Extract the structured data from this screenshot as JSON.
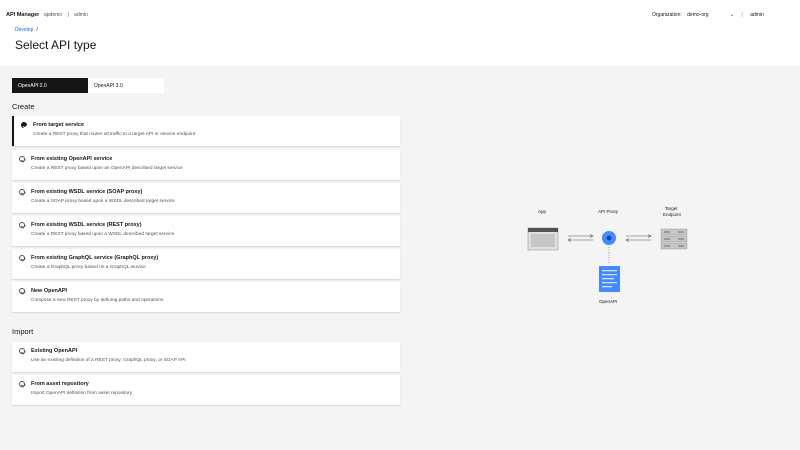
{
  "topbar": {
    "brand": "API Manager",
    "path": [
      "apdemo",
      "|",
      "admin"
    ],
    "org_label": "Organization:",
    "org_value": "demo-org",
    "separator": "|",
    "user": "admin"
  },
  "header": {
    "breadcrumb": "Develop",
    "breadcrumb_sep": "/",
    "title": "Select API type"
  },
  "tabs": [
    {
      "label": "OpenAPI 2.0",
      "active": true
    },
    {
      "label": "OpenAPI 3.0",
      "active": false
    }
  ],
  "create": {
    "heading": "Create",
    "options": [
      {
        "title": "From target service",
        "desc": "Create a REST proxy that routes all traffic to a target API or service endpoint",
        "selected": true
      },
      {
        "title": "From existing OpenAPI service",
        "desc": "Create a REST proxy based upon an OpenAPI described target service",
        "selected": false
      },
      {
        "title": "From existing WSDL service (SOAP proxy)",
        "desc": "Create a SOAP proxy based upon a WSDL described target service",
        "selected": false
      },
      {
        "title": "From existing WSDL service (REST proxy)",
        "desc": "Create a REST proxy based upon a WSDL described target service",
        "selected": false
      },
      {
        "title": "From existing GraphQL service (GraphQL proxy)",
        "desc": "Create a GraphQL proxy based on a GraphQL service",
        "selected": false
      },
      {
        "title": "New OpenAPI",
        "desc": "Compose a new REST proxy by defining paths and operations",
        "selected": false
      }
    ]
  },
  "import": {
    "heading": "Import",
    "options": [
      {
        "title": "Existing OpenAPI",
        "desc": "Use an existing definition of a REST proxy, GraphQL proxy, or SOAP API",
        "selected": false
      },
      {
        "title": "From asset repository",
        "desc": "Import OpenAPI definition from asset repository",
        "selected": false
      }
    ]
  },
  "diagram": {
    "app_label": "App",
    "proxy_label": "API Proxy",
    "target_label_1": "Target",
    "target_label_2": "Endpoint",
    "openapi_label": "OpenAPI"
  },
  "colors": {
    "accent": "#0f62fe",
    "proxy_node": "#4589ff",
    "doc": "#4589ff"
  }
}
